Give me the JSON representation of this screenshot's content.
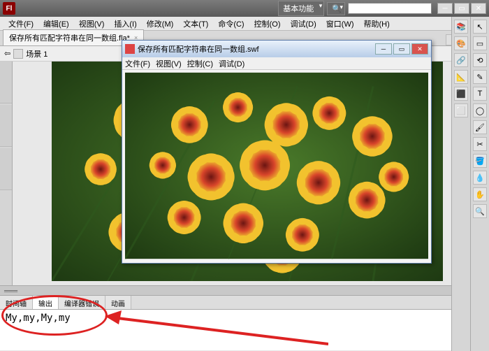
{
  "titlebar": {
    "workspace_label": "基本功能"
  },
  "menubar": [
    "文件(F)",
    "编辑(E)",
    "视图(V)",
    "插入(I)",
    "修改(M)",
    "文本(T)",
    "命令(C)",
    "控制(O)",
    "调试(D)",
    "窗口(W)",
    "帮助(H)"
  ],
  "doctab": {
    "label": "保存所有匹配字符串在同一数组.fla*",
    "close": "×"
  },
  "scene": {
    "label": "场景 1"
  },
  "swf": {
    "title": "保存所有匹配字符串在同一数组.swf",
    "menu": [
      "文件(F)",
      "视图(V)",
      "控制(C)",
      "调试(D)"
    ]
  },
  "panel": {
    "tabs": [
      "时间轴",
      "输出",
      "编译器错误",
      "动画"
    ],
    "active_index": 1,
    "output_text": "My,my,My,my"
  },
  "tools_left": [
    "↖",
    "▭",
    "⟲",
    "✎",
    "T",
    "◯",
    "🖌",
    "✂",
    "🪣",
    "💧",
    "✋",
    "🔍"
  ],
  "tools_right": [
    "📚",
    "🎨",
    "🔗",
    "📐",
    "⬛",
    "⬜"
  ]
}
